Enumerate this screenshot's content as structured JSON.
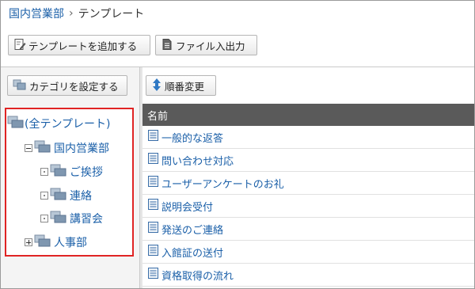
{
  "breadcrumb": {
    "parent": "国内営業部",
    "separator": "›",
    "current": "テンプレート"
  },
  "toolbar": {
    "add_template_label": "テンプレートを追加する",
    "file_io_label": "ファイル入出力"
  },
  "left_pane": {
    "set_category_label": "カテゴリを設定する",
    "tree": {
      "root": "(全テンプレート)",
      "items": [
        {
          "label": "国内営業部",
          "toggle": "minus"
        },
        {
          "label": "ご挨拶",
          "toggle": "dot"
        },
        {
          "label": "連絡",
          "toggle": "dot"
        },
        {
          "label": "講習会",
          "toggle": "dot"
        },
        {
          "label": "人事部",
          "toggle": "plus"
        }
      ]
    }
  },
  "right_pane": {
    "reorder_label": "順番変更",
    "column_header": "名前",
    "rows": [
      "一般的な返答",
      "問い合わせ対応",
      "ユーザーアンケートのお礼",
      "説明会受付",
      "発送のご連絡",
      "入館証の送付",
      "資格取得の流れ"
    ]
  },
  "colors": {
    "link": "#1a5fa8",
    "highlight_border": "#e02424",
    "header_bg": "#5a5a5a"
  },
  "icons": {
    "folder": "folder-icon",
    "document": "document-icon",
    "edit": "edit-icon",
    "sort": "sort-arrows-icon"
  }
}
